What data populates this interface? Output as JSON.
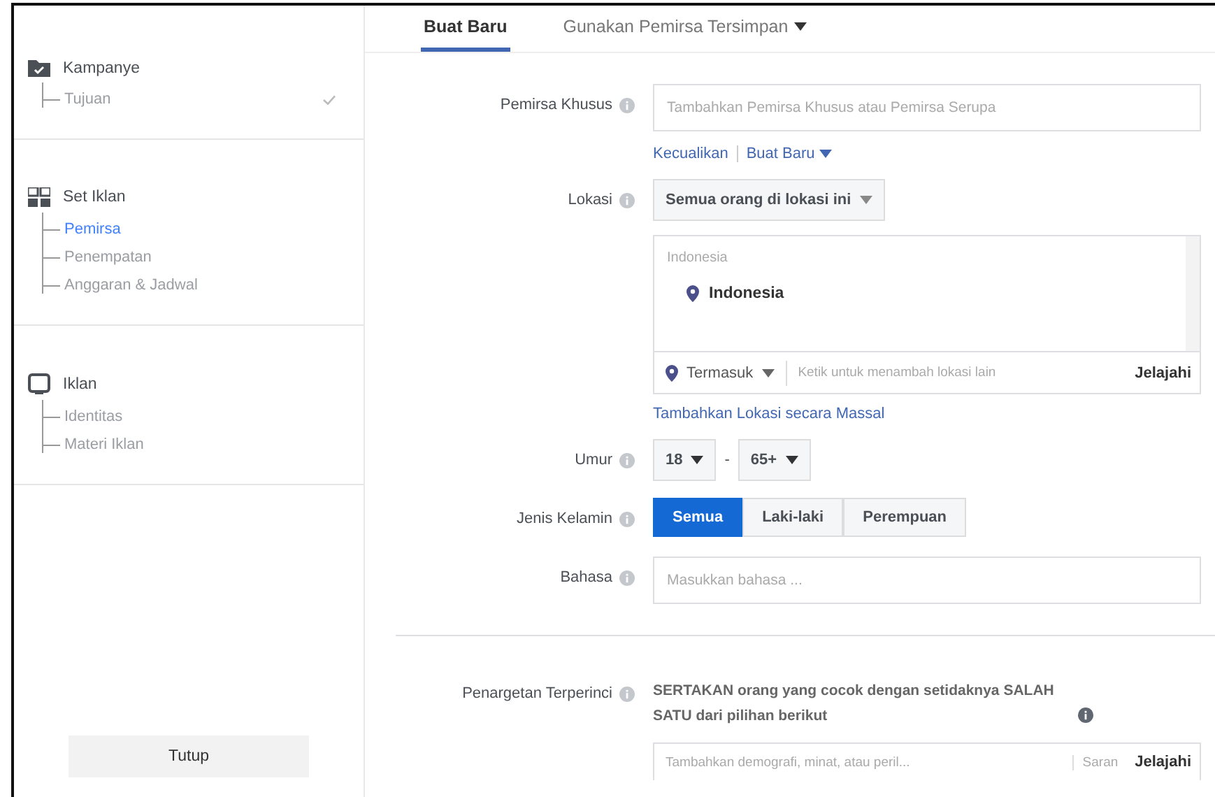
{
  "sidebar": {
    "sections": [
      {
        "title": "Kampanye",
        "kind": "folder",
        "items": [
          {
            "label": "Tujuan",
            "selected": false,
            "done": true
          }
        ]
      },
      {
        "title": "Set Iklan",
        "kind": "grid",
        "items": [
          {
            "label": "Pemirsa",
            "selected": true,
            "done": false
          },
          {
            "label": "Penempatan",
            "selected": false,
            "done": false
          },
          {
            "label": "Anggaran & Jadwal",
            "selected": false,
            "done": false
          }
        ]
      },
      {
        "title": "Iklan",
        "kind": "screen",
        "items": [
          {
            "label": "Identitas",
            "selected": false,
            "done": false
          },
          {
            "label": "Materi Iklan",
            "selected": false,
            "done": false
          }
        ]
      }
    ],
    "close_button": "Tutup"
  },
  "tabs": [
    {
      "label": "Buat Baru",
      "selected": true,
      "dropdown": false
    },
    {
      "label": "Gunakan Pemirsa Tersimpan",
      "selected": false,
      "dropdown": true
    }
  ],
  "form": {
    "custom_audience": {
      "label": "Pemirsa Khusus",
      "placeholder": "Tambahkan Pemirsa Khusus atau Pemirsa Serupa",
      "links": [
        {
          "label": "Kecualikan",
          "dropdown": false
        },
        {
          "label": "Buat Baru",
          "dropdown": true
        }
      ]
    },
    "location": {
      "label": "Lokasi",
      "mode": "Semua orang di lokasi ini",
      "group": "Indonesia",
      "selected": [
        "Indonesia"
      ],
      "include": "Termasuk",
      "placeholder": "Ketik untuk menambah lokasi lain",
      "browse": "Jelajahi",
      "bulk_link": "Tambahkan Lokasi secara Massal"
    },
    "age": {
      "label": "Umur",
      "min": "18",
      "separator": "-",
      "max": "65+"
    },
    "gender": {
      "label": "Jenis Kelamin",
      "options": [
        {
          "label": "Semua",
          "selected": true
        },
        {
          "label": "Laki-laki",
          "selected": false
        },
        {
          "label": "Perempuan",
          "selected": false
        }
      ]
    },
    "language": {
      "label": "Bahasa",
      "placeholder": "Masukkan bahasa ..."
    },
    "detailed": {
      "label": "Penargetan Terperinci",
      "description": "SERTAKAN orang yang cocok dengan setidaknya SALAH SATU dari pilihan berikut",
      "placeholder": "Tambahkan demografi, minat, atau peril...",
      "suggestions": "Saran",
      "browse": "Jelajahi"
    }
  }
}
